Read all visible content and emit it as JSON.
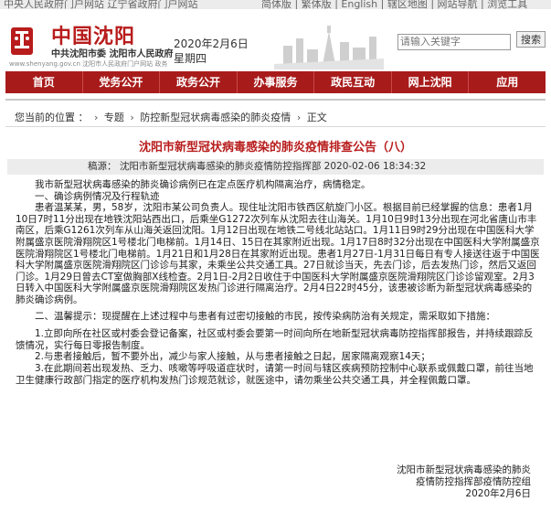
{
  "topbar": {
    "left_text": "中央人民政府门户网站  辽宁省政府门户网站",
    "right_text": "简体版 | 繁体版 | English | 辖区地图 | 网站导航 | 浏览工具"
  },
  "header": {
    "site_title": "中国沈阳",
    "site_subtitle": "中共沈阳市委  沈阳市人民政府",
    "site_url": "www.shenyang.gov.cn 沈阳市人民政府门户网站 政务",
    "date": "2020年2月6日 星期四"
  },
  "search": {
    "placeholder": "请输入关键字",
    "button_label": "搜索"
  },
  "nav": {
    "items": [
      "首页",
      "党务公开",
      "政务公开",
      "办事服务",
      "政民互动",
      "网上沈阳",
      "应用"
    ]
  },
  "breadcrumb": {
    "prefix": "您当前的位置 ：",
    "items": [
      "专题",
      "防控新型冠状病毒感染的肺炎疫情",
      "正文"
    ]
  },
  "article": {
    "title": "沈阳市新型冠状病毒感染的肺炎疫情排查公告（八）",
    "meta": "稿源： 沈阳市新型冠状病毒感染的肺炎疫情防控指挥部  2020-02-06  18:34:32",
    "paragraphs": [
      "我市新型冠状病毒感染的肺炎确诊病例已在定点医疗机构隔离治疗，病情稳定。",
      "一、确诊病例情况及行程轨迹",
      "患者温某某，男，58岁，沈阳市某公司负责人。现住址沈阳市铁西区航旋门小区。根据目前已经掌握的信息：患者1月10日7时11分出现在地铁沈阳站西出口，后乘坐G1272次列车从沈阳去往山海关。1月10日9时13分出现在河北省唐山市丰南区，后乘G1261次列车从山海关返回沈阳。1月12日出现在地铁二号线北站站口。1月11日9时29分出现在中国医科大学附属盛京医院滑翔院区1号楼北门电梯前。1月14日、15日在其家附近出现。1月17日8时32分出现在中国医科大学附属盛京医院滑翔院区1号楼北门电梯前。1月21日和1月28日在其家附近出现。患者1月27日-1月31日每日有专人接送往返于中国医科大学附属盛京医院滑翔院区门诊诊与其家，未乘坐公共交通工具。27日就诊当天，先去门诊，后去发热门诊，然后又返回门诊。1月29日曾去CT室做胸部X线检查。2月1日-2月2日收住于中国医科大学附属盛京医院滑翔院区门诊诊留观室。2月3日转入中国医科大学附属盛京医院滑翔院区发热门诊进行隔离治疗。2月4日22时45分，该患被诊断为新型冠状病毒感染的肺炎确诊病例。",
      "二、温馨提示：现提醒在上述过程中与患者有过密切接触的市民，按传染病防治有关规定，需采取如下措施：",
      "1.立即向所在社区或村委会登记备案，社区或村委会要第一时间向所在地新型冠状病毒防控指挥部报告，并持续跟踪反馈情况，实行每日零报告制度。",
      "2.与患者接触后，暂不要外出，减少与家人接触，从与患者接触之日起，居家隔离观察14天；",
      "3.在此期间若出现发热、乏力、咳嗽等呼吸道症状时，请第一时间与辖区疾病预防控制中心联系或佩戴口罩，前往当地卫生健康行政部门指定的医疗机构发热门诊规范就诊，就医途中，请勿乘坐公共交通工具，并全程佩戴口罩。"
    ],
    "sign": {
      "line1": "沈阳市新型冠状病毒感染的肺炎",
      "line2": "疫情防控指挥部疫情防控组",
      "date": "2020年2月6日"
    }
  },
  "colors": {
    "brand_red": "#a81b1b",
    "title_red": "#b81c1c",
    "meta_bg": "#ececec"
  },
  "icons": {
    "logo": "shenyang-logo-icon",
    "skyline": "skyline-banner"
  }
}
